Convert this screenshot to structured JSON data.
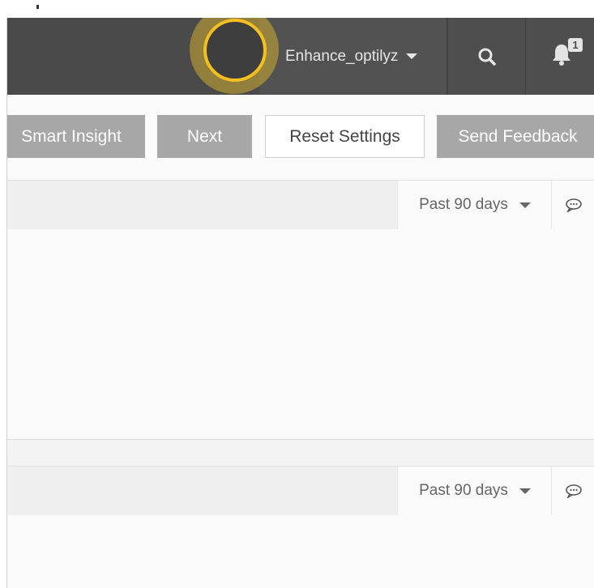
{
  "header": {
    "username": "Enhance_optilyz",
    "notification_count": "1",
    "icons": [
      "search-icon",
      "bell-icon",
      "chevron-down-icon"
    ]
  },
  "toolbar": {
    "smart_insight_label": "Smart Insight",
    "next_label": "Next",
    "reset_settings_label": "Reset Settings",
    "send_feedback_label": "Send Feedback"
  },
  "panels": [
    {
      "date_range": "Past 90 days",
      "icon": "comment-icon"
    },
    {
      "date_range": "Past 90 days",
      "icon": "comment-icon"
    }
  ],
  "colors": {
    "topbar": "#4a4a4a",
    "highlight": "#f4c020",
    "button_gray": "#a7a7a7",
    "page_bg": "#fafafa"
  }
}
